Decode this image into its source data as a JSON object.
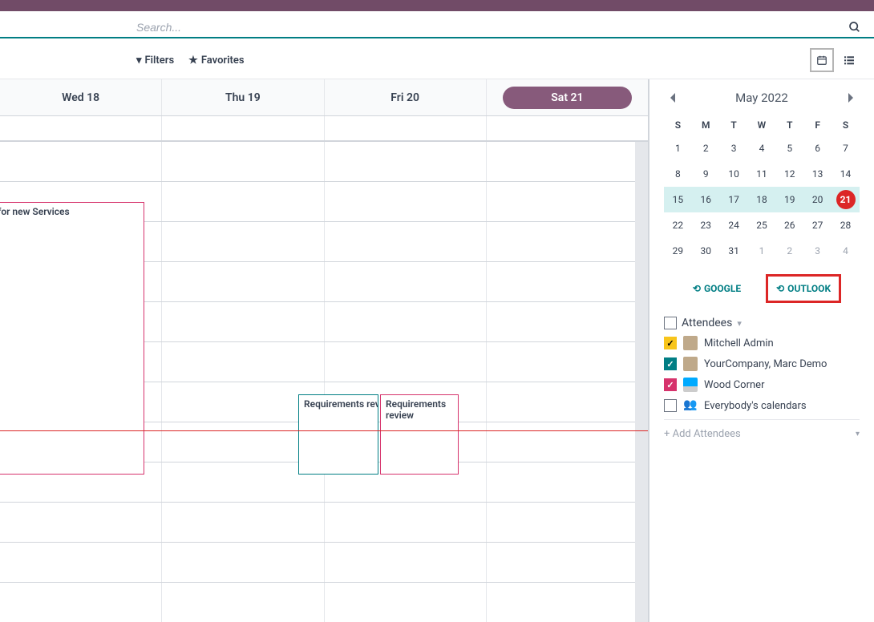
{
  "search": {
    "placeholder": "Search..."
  },
  "toolbar": {
    "filters": "Filters",
    "favorites": "Favorites"
  },
  "week": {
    "days": [
      "Wed 18",
      "Thu 19",
      "Fri 20",
      "Sat 21"
    ],
    "selected_index": 3
  },
  "events": {
    "ev1": "ation for new Services",
    "ev2": "Requirements rev",
    "ev3": "Requirements review"
  },
  "minical": {
    "month": "May 2022",
    "dow": [
      "S",
      "M",
      "T",
      "W",
      "T",
      "F",
      "S"
    ],
    "weeks": [
      [
        {
          "n": 1
        },
        {
          "n": 2
        },
        {
          "n": 3
        },
        {
          "n": 4
        },
        {
          "n": 5
        },
        {
          "n": 6
        },
        {
          "n": 7
        }
      ],
      [
        {
          "n": 8
        },
        {
          "n": 9
        },
        {
          "n": 10
        },
        {
          "n": 11
        },
        {
          "n": 12
        },
        {
          "n": 13
        },
        {
          "n": 14
        }
      ],
      [
        {
          "n": 15,
          "hl": true
        },
        {
          "n": 16,
          "hl": true
        },
        {
          "n": 17,
          "hl": true
        },
        {
          "n": 18,
          "hl": true
        },
        {
          "n": 19,
          "hl": true
        },
        {
          "n": 20,
          "hl": true
        },
        {
          "n": 21,
          "hl": true,
          "today": true
        }
      ],
      [
        {
          "n": 22
        },
        {
          "n": 23
        },
        {
          "n": 24
        },
        {
          "n": 25
        },
        {
          "n": 26
        },
        {
          "n": 27
        },
        {
          "n": 28
        }
      ],
      [
        {
          "n": 29
        },
        {
          "n": 30
        },
        {
          "n": 31
        },
        {
          "n": 1,
          "muted": true
        },
        {
          "n": 2,
          "muted": true
        },
        {
          "n": 3,
          "muted": true
        },
        {
          "n": 4,
          "muted": true
        }
      ]
    ]
  },
  "sync": {
    "google": "GOOGLE",
    "outlook": "OUTLOOK"
  },
  "attendees": {
    "title": "Attendees",
    "list": [
      {
        "name": "Mitchell Admin",
        "color": "yellow",
        "checked": true,
        "avatar": "person"
      },
      {
        "name": "YourCompany, Marc Demo",
        "color": "teal",
        "checked": true,
        "avatar": "person"
      },
      {
        "name": "Wood Corner",
        "color": "pink",
        "checked": true,
        "avatar": "screen"
      },
      {
        "name": "Everybody's calendars",
        "color": "",
        "checked": false,
        "avatar": "group"
      }
    ],
    "add_placeholder": "+ Add Attendees"
  }
}
